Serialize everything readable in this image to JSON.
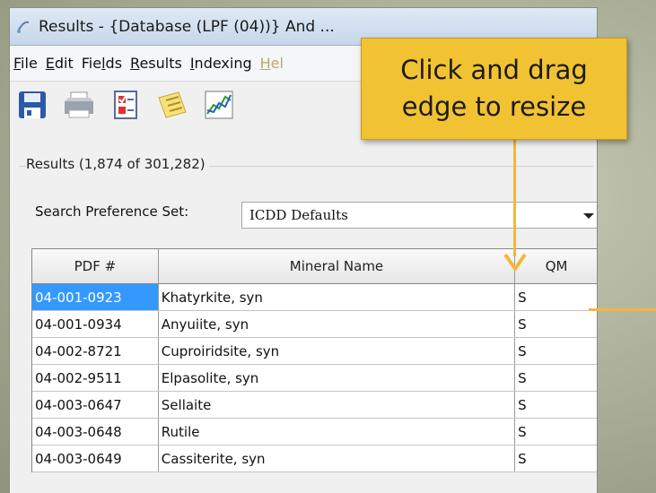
{
  "window": {
    "title": "Results - {Database (LPF (04))} And ...",
    "app_icon": "app-icon"
  },
  "menu": [
    {
      "label": "File",
      "u": "F",
      "rest": "ile"
    },
    {
      "label": "Edit",
      "u": "E",
      "rest": "dit"
    },
    {
      "label": "Fields",
      "u": "",
      "pre": "Fie",
      "u2": "l",
      "post": "ds"
    },
    {
      "label": "Results",
      "u": "R",
      "rest": "esults"
    },
    {
      "label": "Indexing",
      "u": "I",
      "rest": "ndexing"
    },
    {
      "label": "Hel",
      "u": "H",
      "rest": "el"
    }
  ],
  "toolbar": {
    "icons": [
      "save-icon",
      "print-icon",
      "checklist-icon",
      "notes-icon",
      "chart-icon"
    ]
  },
  "results": {
    "label": "Results (1,874 of 301,282)"
  },
  "search_pref": {
    "label": "Search Preference Set:",
    "value": "ICDD Defaults"
  },
  "grid": {
    "columns": [
      "PDF #",
      "Mineral Name",
      "QM"
    ],
    "rows": [
      {
        "pdf": "04-001-0923",
        "name": "Khatyrkite, syn",
        "qm": "S",
        "selected": true
      },
      {
        "pdf": "04-001-0934",
        "name": "Anyuiite, syn",
        "qm": "S",
        "selected": false
      },
      {
        "pdf": "04-002-8721",
        "name": "Cuproiridsite, syn",
        "qm": "S",
        "selected": false
      },
      {
        "pdf": "04-002-9511",
        "name": "Elpasolite, syn",
        "qm": "S",
        "selected": false
      },
      {
        "pdf": "04-003-0647",
        "name": "Sellaite",
        "qm": "S",
        "selected": false
      },
      {
        "pdf": "04-003-0648",
        "name": "Rutile",
        "qm": "S",
        "selected": false
      },
      {
        "pdf": "04-003-0649",
        "name": "Cassiterite, syn",
        "qm": "S",
        "selected": false
      }
    ]
  },
  "callout": {
    "line1": "Click and drag",
    "line2": "edge to resize",
    "color": "#f1c232"
  }
}
